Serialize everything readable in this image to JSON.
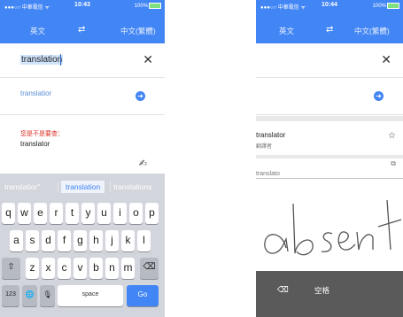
{
  "left": {
    "status": {
      "carrier": "●●●○○ 中華電信 ᯤ",
      "time": "10:43",
      "battery": "100%"
    },
    "lang": {
      "source": "英文",
      "swap_icon": "⇄",
      "target": "中文(繁體)"
    },
    "input": {
      "value": "translation",
      "clear_icon": "✕"
    },
    "suggestion": {
      "text": "translatior"
    },
    "did_you_mean": {
      "label": "您是不是要查：",
      "word": "translator"
    },
    "handwriting_icon": "✍",
    "predictions": [
      "translatior\"",
      "translation",
      "translations"
    ],
    "keyboard": {
      "row1": [
        "q",
        "w",
        "e",
        "r",
        "t",
        "y",
        "u",
        "i",
        "o",
        "p"
      ],
      "row2": [
        "a",
        "s",
        "d",
        "f",
        "g",
        "h",
        "j",
        "k",
        "l"
      ],
      "row3": [
        "z",
        "x",
        "c",
        "v",
        "b",
        "n",
        "m"
      ],
      "shift": "⇧",
      "delete": "⌫",
      "num": "123",
      "globe": "🌐",
      "mic": "🎙",
      "space": "space",
      "go": "Go"
    }
  },
  "right": {
    "status": {
      "carrier": "●●●○○ 中華電信 ᯤ",
      "time": "10:44",
      "battery": "100%"
    },
    "lang": {
      "source": "英文",
      "swap_icon": "⇄",
      "target": "中文(繁體)"
    },
    "input": {
      "clear_icon": "✕"
    },
    "result1": {
      "word": "translator",
      "translation": "翻譯者",
      "star_icon": "☆"
    },
    "result2": {
      "word": "translato",
      "copy_icon": "⧉"
    },
    "handwriting": {
      "text": "absent"
    },
    "hw_bar": {
      "backspace": "⌫",
      "space": "空格"
    }
  }
}
